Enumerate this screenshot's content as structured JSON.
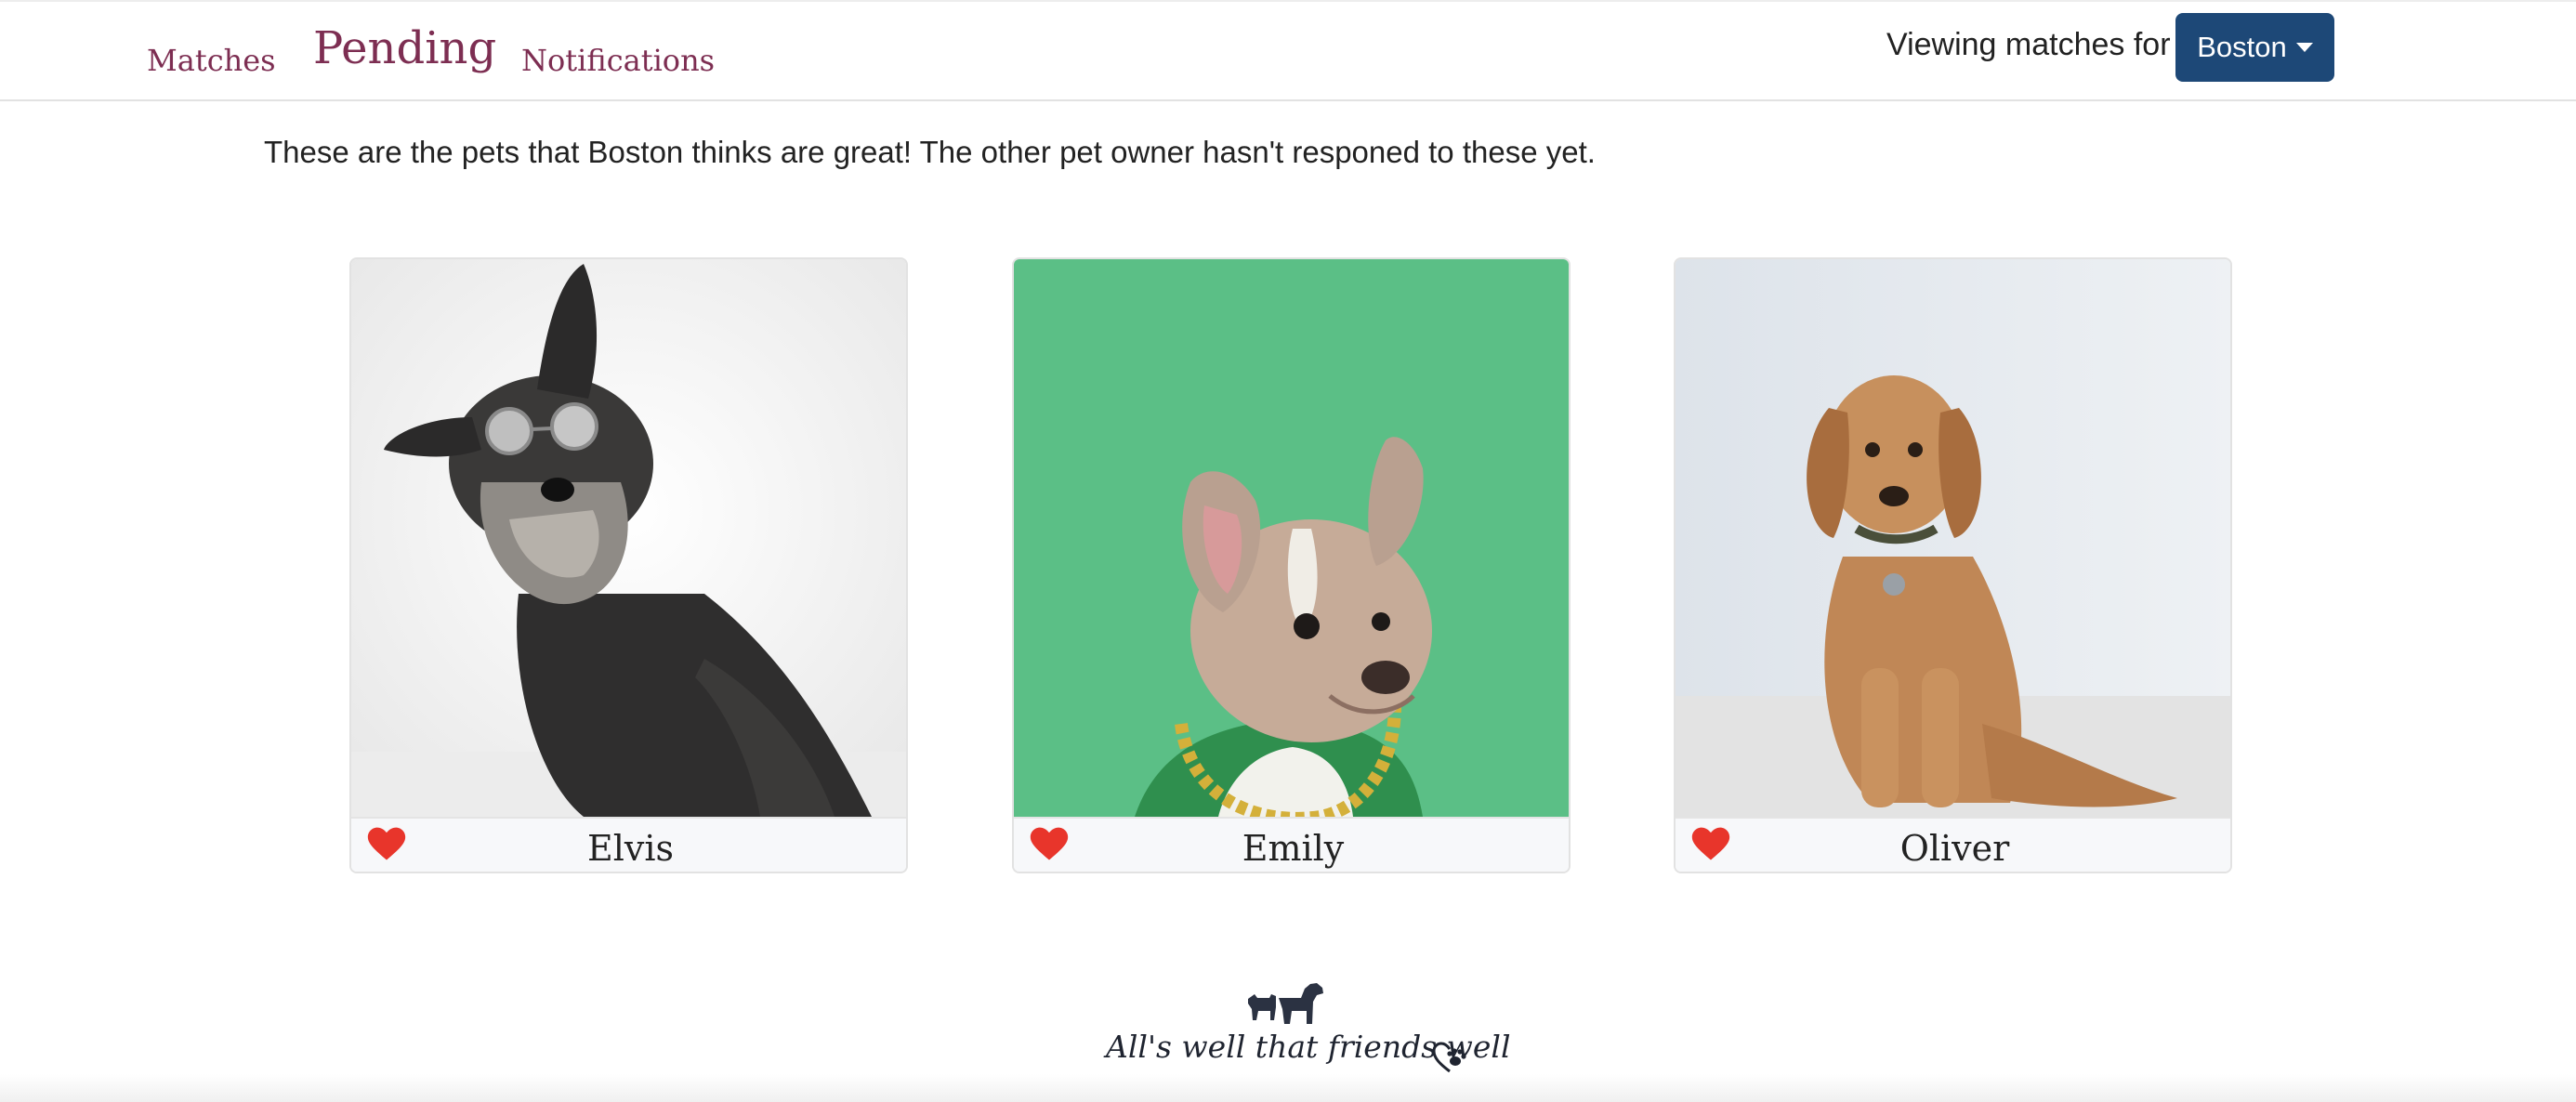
{
  "nav": {
    "tabs": [
      {
        "label": "Matches"
      },
      {
        "label": "Pending"
      },
      {
        "label": "Notifications"
      }
    ],
    "viewing_label": "Viewing matches for",
    "selected_pet": "Boston",
    "dropdown_color": "#1d4877"
  },
  "main": {
    "intro": "These are the pets that Boston thinks are great! The other pet owner hasn't responed to these yet.",
    "cards": [
      {
        "name": "Elvis",
        "icon": "heart-icon"
      },
      {
        "name": "Emily",
        "icon": "heart-icon"
      },
      {
        "name": "Oliver",
        "icon": "heart-icon"
      }
    ]
  },
  "footer": {
    "tagline": "All's well that friends well"
  },
  "colors": {
    "accent": "#7d2e52",
    "heart": "#e8352b",
    "text": "#222222"
  }
}
